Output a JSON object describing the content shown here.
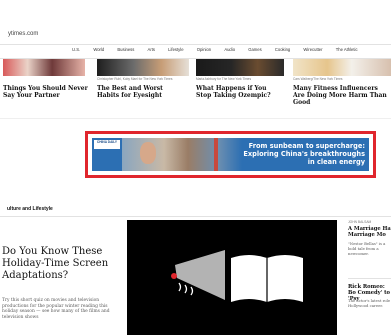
{
  "site": {
    "url": "ytimes.com"
  },
  "nav": [
    "U.S.",
    "World",
    "Business",
    "Arts",
    "Lifestyle",
    "Opinion",
    "Audio",
    "Games",
    "Cooking",
    "Wirecutter",
    "The Athletic"
  ],
  "stories": [
    {
      "credit": "",
      "headline": "Things You Should Never Say Your Partner"
    },
    {
      "credit": "Christopher Ruhl, Koby Mael for The New York Times",
      "headline": "The Best and Worst Habits for Eyesight"
    },
    {
      "credit": "Maria Ashbury for The New York Times",
      "headline": "What Happens if You Stop Taking Ozempic?"
    },
    {
      "credit": "Cars Walberg/The New York Times",
      "headline": "Many Fitness Influencers Are Doing More Harm Than Good"
    }
  ],
  "ad": {
    "logo": "CHINA DAILY",
    "text": "From sunbeam to supercharge: Exploring China's breakthroughs in clean energy"
  },
  "section": {
    "label": "ulture and Lifestyle"
  },
  "lead": {
    "headline": "Do You Know These Holiday-Time Screen Adaptations?",
    "summary": "Try this short quiz on movies and television productions for the popular winter reading this holiday season — see how many of the films and television shows"
  },
  "sidebar": {
    "byline": "JOHN BALSAM",
    "items": [
      {
        "headline": "A Marriage Hat Marriage Mo",
        "summary": "\"Nestor Bellas\" is a bold tale from a newcomer."
      },
      {
        "headline": "Rick Romeo: Bo Comedy' to 'Psy",
        "summary": "The actor's latest role a Hollywood career."
      }
    ]
  },
  "colors": {
    "accent": "#e0262d",
    "ad_blue": "#2c6fb3",
    "text": "#121212",
    "muted": "#5a5a5a"
  }
}
